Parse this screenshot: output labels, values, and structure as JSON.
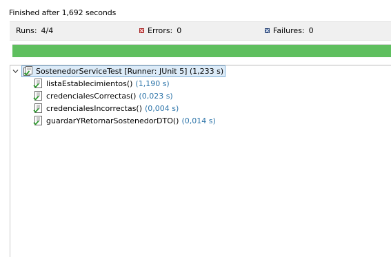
{
  "status": {
    "message": "Finished after 1,692 seconds"
  },
  "counters": {
    "runs_label": "Runs:",
    "runs_value": "4/4",
    "errors_label": "Errors:",
    "errors_value": "0",
    "failures_label": "Failures:",
    "failures_value": "0"
  },
  "progress": {
    "fraction": 1.0,
    "color": "#5fbf5f"
  },
  "tree": {
    "suite": {
      "label": "SostenedorServiceTest [Runner: JUnit 5] (1,233 s)",
      "expanded": true,
      "icon": "test-suite-passed-icon"
    },
    "tests": [
      {
        "name": "listaEstablecimientos()",
        "time": "(1,190 s)",
        "icon": "test-passed-icon"
      },
      {
        "name": "credencialesCorrectas()",
        "time": "(0,023 s)",
        "icon": "test-passed-icon"
      },
      {
        "name": "credencialesIncorrectas()",
        "time": "(0,004 s)",
        "icon": "test-passed-icon"
      },
      {
        "name": "guardarYRetornarSostenedorDTO()",
        "time": "(0,014 s)",
        "icon": "test-passed-icon"
      }
    ]
  },
  "colors": {
    "success": "#5fbf5f",
    "time_text": "#2b73a8",
    "selection": "#dcebf8"
  }
}
